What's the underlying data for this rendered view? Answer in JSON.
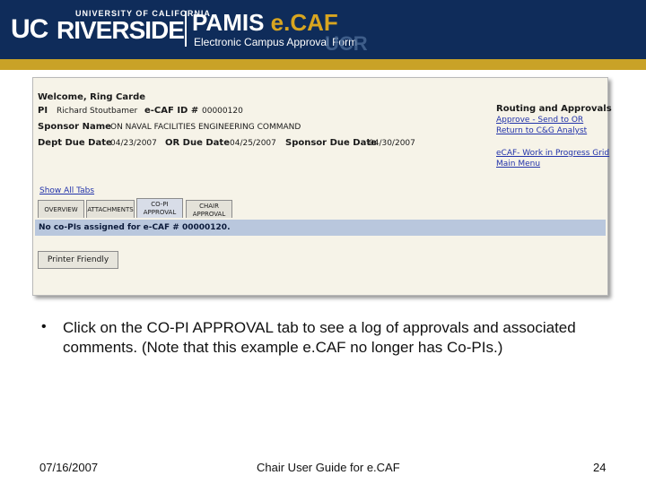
{
  "banner": {
    "logo_uc": "UC",
    "logo_university": "UNIVERSITY OF CALIFORNIA",
    "logo_riverside": "RIVERSIDE",
    "app_pamis": "PAMIS",
    "app_ecaf": "e.CAF",
    "app_subtitle": "Electronic Campus Approval Form",
    "watermark": "UCR"
  },
  "screen": {
    "welcome": "Welcome, Ring Carde",
    "pi_label": "PI",
    "pi_value": "Richard Stoutbamer",
    "ecaf_id_label": "e-CAF ID #",
    "ecaf_id_value": "00000120",
    "sponsor_label": "Sponsor Name",
    "sponsor_value": "ON NAVAL FACILITIES ENGINEERING COMMAND",
    "dept_due_label": "Dept Due Date",
    "dept_due_value": "04/23/2007",
    "or_due_label": "OR Due Date",
    "or_due_value": "04/25/2007",
    "sponsor_due_label": "Sponsor Due Date",
    "sponsor_due_value": "04/30/2007",
    "routing_title": "Routing and Approvals",
    "routing_links": [
      "Approve - Send to OR",
      "Return to C&G Analyst"
    ],
    "nav_links": [
      "eCAF- Work in Progress Grid",
      "Main Menu"
    ],
    "show_all_tabs": "Show All Tabs",
    "tabs": [
      "OVERVIEW",
      "ATTACHMENTS",
      "CO-PI APPROVAL",
      "CHAIR APPROVAL"
    ],
    "active_tab": "CO-PI APPROVAL",
    "message": "No co-PIs assigned for e-CAF # 00000120.",
    "printer_button": "Printer Friendly"
  },
  "slide": {
    "bullet": "Click on the CO-PI APPROVAL tab to see a log of approvals and associated comments. (Note that this example e.CAF no longer has Co-PIs.)",
    "footer_date": "07/16/2007",
    "footer_title": "Chair User Guide for e.CAF",
    "page_number": "24"
  },
  "colors": {
    "banner_navy": "#0f2c5a",
    "banner_gold": "#c9a227",
    "screen_bg": "#f6f3e8",
    "status_bar": "#b9c7dd",
    "link_blue": "#2233aa"
  }
}
